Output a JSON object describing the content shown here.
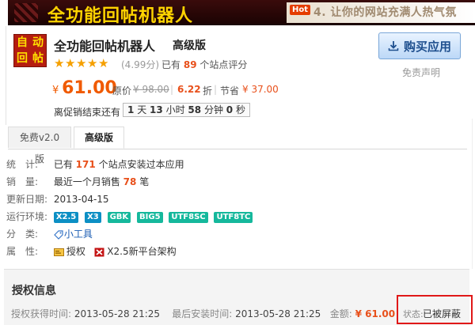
{
  "banner": {
    "title": "全功能回帖机器人",
    "hot_badge": "Hot",
    "slogan": "4. 让你的网站充满人热气氛"
  },
  "product": {
    "icon_chars": [
      "自",
      "动",
      "回",
      "帖"
    ],
    "title": "全功能回帖机器人",
    "edition": "高级版",
    "rating_stars": 5,
    "rating_score": "(4.99分)",
    "rating_prefix": "已有",
    "rating_count": "89",
    "rating_suffix": "个站点评分",
    "currency": "¥",
    "price": "61.00",
    "orig_label": "原价",
    "orig_price": "¥ 98.00",
    "discount": "6.22",
    "discount_unit": "折",
    "save_label": "节省",
    "save_amount": "¥ 37.00",
    "countdown_label": "离促销结束还有",
    "countdown": {
      "days": "1",
      "days_unit": "天",
      "hours": "13",
      "hours_unit": "小时",
      "minutes": "58",
      "minutes_unit": "分钟",
      "seconds": "0",
      "seconds_unit": "秒"
    }
  },
  "actions": {
    "buy_label": "购买应用",
    "disclaimer": "免责声明"
  },
  "tabs": [
    {
      "label": "免费v2.0版",
      "active": false
    },
    {
      "label": "高级版",
      "active": true
    }
  ],
  "info": {
    "stats_label": "统　计:",
    "stats_prefix": "已有",
    "stats_count": "171",
    "stats_suffix": "个站点安装过本应用",
    "sales_label": "销　量:",
    "sales_prefix": "最近一个月销售",
    "sales_count": "78",
    "sales_suffix": "笔",
    "updated_label": "更新日期:",
    "updated_value": "2013-04-15",
    "env_label": "运行环境:",
    "env_tags": [
      "X2.5",
      "X3",
      "GBK",
      "BIG5",
      "UTF8SC",
      "UTF8TC"
    ],
    "category_label": "分　类:",
    "category_value": "小工具",
    "attr_label": "属　性:",
    "attr_auth": "授权",
    "attr_platform": "X2.5新平台架构"
  },
  "auth": {
    "title": "授权信息",
    "obtained_label": "授权获得时间:",
    "obtained_value": "2013-05-28 21:25",
    "installed_label": "最后安装时间:",
    "installed_value": "2013-05-28 21:25",
    "amount_label": "金额:",
    "amount_value": "¥ 61.00",
    "status_label": "状态:",
    "status_value": "已被屏蔽"
  },
  "colors": {
    "price": "#f05a00",
    "highlight": "#e8501b",
    "link": "#1a5cb3",
    "status_border": "#e01818"
  }
}
